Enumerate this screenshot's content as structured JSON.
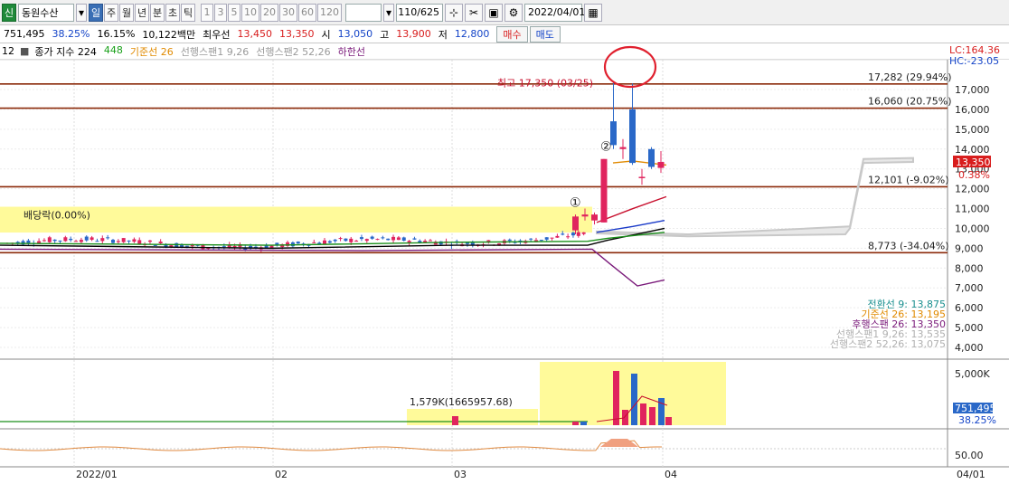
{
  "toolbar": {
    "stock_badge": "신",
    "stock_name": "동원수산",
    "periods": [
      "일",
      "주",
      "월",
      "년",
      "분",
      "초",
      "틱"
    ],
    "selected_period": "일",
    "minute_steps": [
      "1",
      "3",
      "5",
      "10",
      "20",
      "30",
      "60",
      "120"
    ],
    "count_value": "110",
    "count_total": "/625",
    "date_value": "2022/04/01"
  },
  "quote": {
    "volume": "751,495",
    "volume_rate": "38.25%",
    "change_rate": "16.15%",
    "amount": "10,122백만",
    "best_label": "최우선",
    "best_ask": "13,450",
    "best_bid": "13,350",
    "open_label": "시",
    "open": "13,050",
    "high_label": "고",
    "high": "13,900",
    "low_label": "저",
    "low": "12,800",
    "buy_label": "매수",
    "sell_label": "매도"
  },
  "legend": {
    "prefix": "12",
    "items": [
      {
        "text": "종가 지수 224",
        "color": "#000000"
      },
      {
        "text": "448",
        "color": "#18a018"
      },
      {
        "text": "기준선 26",
        "color": "#e08a00"
      },
      {
        "text": "선행스팬1 9,26",
        "color": "#9a9a9a"
      },
      {
        "text": "선행스팬2 52,26",
        "color": "#9a9a9a"
      },
      {
        "text": "하한선",
        "color": "#7a1a7a"
      }
    ]
  },
  "right_info": {
    "lc": "LC:164.36",
    "hc": "HC:-23.05"
  },
  "price_axis": [
    "17,000",
    "16,000",
    "15,000",
    "14,000",
    "13,000",
    "12,000",
    "11,000",
    "10,000",
    "9,000",
    "8,000",
    "7,000",
    "6,000",
    "5,000",
    "4,000"
  ],
  "current_price": "13,350",
  "current_change": "0.38%",
  "levels": [
    {
      "price": 17282,
      "label": "17,282 (29.94%)"
    },
    {
      "price": 16060,
      "label": "16,060 (20.75%)"
    },
    {
      "price": 12101,
      "label": "12,101 (-9.02%)"
    },
    {
      "price": 8773,
      "label": "8,773 (-34.04%)"
    }
  ],
  "annotations": {
    "high_marker": "최고 17,350 (03/25)",
    "dividend": "배당락(0.00%)",
    "circle1": "①",
    "circle2": "②",
    "volume_note": "1,579K(1665957.68)"
  },
  "ichimoku_legend": [
    {
      "text": "전환선 9: 13,875",
      "color": "#1a8f8f"
    },
    {
      "text": "기준선 26: 13,195",
      "color": "#e08a00"
    },
    {
      "text": "후행스팬 26: 13,350",
      "color": "#7a1a7a"
    },
    {
      "text": "선행스팬1 9,26: 13,535",
      "color": "#b0b0b0"
    },
    {
      "text": "선행스팬2 52,26: 13,075",
      "color": "#b0b0b0"
    }
  ],
  "volume_axis": "5,000K",
  "volume_current": "751,495",
  "volume_current_rate": "38.25%",
  "oscillator_axis": "50.00",
  "date_axis": [
    {
      "label": "2022/01"
    },
    {
      "label": "02"
    },
    {
      "label": "03"
    },
    {
      "label": "04"
    },
    {
      "label": "04/01"
    }
  ],
  "colors": {
    "up": "#e0245e",
    "down": "#2a68c8",
    "level_line": "#8b2a0a",
    "highlight": "#fffa9a",
    "cloud": "#c8c8c8"
  },
  "chart_data": {
    "type": "candlestick",
    "title": "",
    "ylim": [
      3500,
      17800
    ],
    "candles_recent": [
      {
        "o": 9900,
        "h": 10700,
        "l": 9700,
        "c": 10600
      },
      {
        "o": 10600,
        "h": 11000,
        "l": 10400,
        "c": 10700
      },
      {
        "o": 10400,
        "h": 10800,
        "l": 10200,
        "c": 10700
      },
      {
        "o": 10300,
        "h": 13500,
        "l": 10300,
        "c": 13500
      },
      {
        "o": 15400,
        "h": 17350,
        "l": 14000,
        "c": 14200
      },
      {
        "o": 14000,
        "h": 14500,
        "l": 13500,
        "c": 14100
      },
      {
        "o": 16000,
        "h": 17300,
        "l": 13200,
        "c": 13300
      },
      {
        "o": 12600,
        "h": 13000,
        "l": 12200,
        "c": 12600
      },
      {
        "o": 14000,
        "h": 14100,
        "l": 13000,
        "c": 13100
      },
      {
        "o": 13050,
        "h": 13900,
        "l": 12800,
        "c": 13350
      }
    ]
  }
}
